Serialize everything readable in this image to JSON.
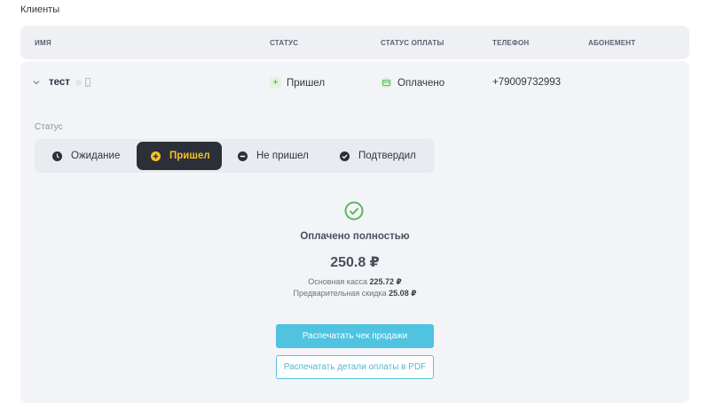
{
  "page": {
    "section_title": "Клиенты"
  },
  "table": {
    "headers": {
      "name": "ИМЯ",
      "status": "СТАТУС",
      "payment_status": "СТАТУС ОПЛАТЫ",
      "phone": "ТЕЛЕФОН",
      "subscription": "АБОНЕМЕНТ"
    }
  },
  "row": {
    "name": "тест",
    "status": "Пришел",
    "payment_status": "Оплачено",
    "phone": "+79009732993",
    "subscription": ""
  },
  "details": {
    "status_label": "Статус",
    "options": [
      {
        "label": "Ожидание",
        "icon": "clock-icon",
        "active": false
      },
      {
        "label": "Пришел",
        "icon": "plus-circle-icon",
        "active": true
      },
      {
        "label": "Не пришел",
        "icon": "minus-circle-icon",
        "active": false
      },
      {
        "label": "Подтвердил",
        "icon": "check-circle-icon",
        "active": false
      }
    ],
    "paid_title": "Оплачено полностью",
    "total": "250.8 ₽",
    "main_cash_label": "Основная касса",
    "main_cash_value": "225.72 ₽",
    "discount_label": "Предварительная скидка",
    "discount_value": "25.08 ₽",
    "print_receipt": "Распечатать чек продажи",
    "print_pdf": "Распечатать детали оплаты в PDF"
  },
  "colors": {
    "accent": "#4fc3e0",
    "active_segment_bg": "#2b2f38",
    "active_segment_text": "#f4c127",
    "success": "#5cb85c"
  }
}
